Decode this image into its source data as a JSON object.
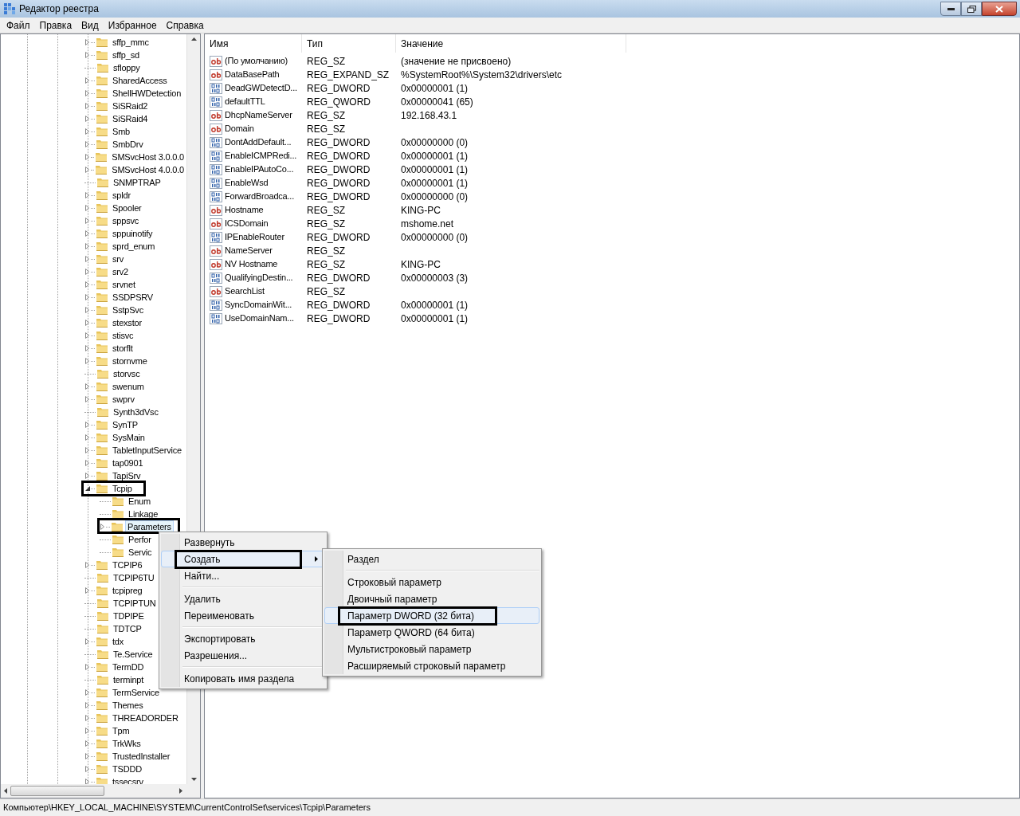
{
  "window": {
    "title": "Редактор реестра"
  },
  "menu": [
    "Файл",
    "Правка",
    "Вид",
    "Избранное",
    "Справка"
  ],
  "tree": [
    {
      "label": "sffp_mmc",
      "expandable": true
    },
    {
      "label": "sffp_sd",
      "expandable": true
    },
    {
      "label": "sfloppy",
      "expandable": false
    },
    {
      "label": "SharedAccess",
      "expandable": true
    },
    {
      "label": "ShellHWDetection",
      "expandable": true
    },
    {
      "label": "SiSRaid2",
      "expandable": true
    },
    {
      "label": "SiSRaid4",
      "expandable": true
    },
    {
      "label": "Smb",
      "expandable": true
    },
    {
      "label": "SmbDrv",
      "expandable": true
    },
    {
      "label": "SMSvcHost 3.0.0.0",
      "expandable": true
    },
    {
      "label": "SMSvcHost 4.0.0.0",
      "expandable": true
    },
    {
      "label": "SNMPTRAP",
      "expandable": false
    },
    {
      "label": "spldr",
      "expandable": true
    },
    {
      "label": "Spooler",
      "expandable": true
    },
    {
      "label": "sppsvc",
      "expandable": true
    },
    {
      "label": "sppuinotify",
      "expandable": true
    },
    {
      "label": "sprd_enum",
      "expandable": true
    },
    {
      "label": "srv",
      "expandable": true
    },
    {
      "label": "srv2",
      "expandable": true
    },
    {
      "label": "srvnet",
      "expandable": true
    },
    {
      "label": "SSDPSRV",
      "expandable": true
    },
    {
      "label": "SstpSvc",
      "expandable": true
    },
    {
      "label": "stexstor",
      "expandable": true
    },
    {
      "label": "stisvc",
      "expandable": true
    },
    {
      "label": "storflt",
      "expandable": true
    },
    {
      "label": "stornvme",
      "expandable": true
    },
    {
      "label": "storvsc",
      "expandable": false
    },
    {
      "label": "swenum",
      "expandable": true
    },
    {
      "label": "swprv",
      "expandable": true
    },
    {
      "label": "Synth3dVsc",
      "expandable": false
    },
    {
      "label": "SynTP",
      "expandable": true
    },
    {
      "label": "SysMain",
      "expandable": true
    },
    {
      "label": "TabletInputService",
      "expandable": true
    },
    {
      "label": "tap0901",
      "expandable": true
    },
    {
      "label": "TapiSrv",
      "expandable": true
    },
    {
      "label": "Tcpip",
      "expandable": true,
      "expanded": true,
      "annotated": true,
      "children": [
        {
          "label": "Enum",
          "expandable": false
        },
        {
          "label": "Linkage",
          "expandable": false
        },
        {
          "label": "Parameters",
          "expandable": true,
          "selected": true,
          "annotated": true
        },
        {
          "label": "Perfor",
          "expandable": false
        },
        {
          "label": "Servic",
          "expandable": false
        }
      ]
    },
    {
      "label": "TCPIP6",
      "expandable": true
    },
    {
      "label": "TCPIP6TU",
      "expandable": false
    },
    {
      "label": "tcpipreg",
      "expandable": true
    },
    {
      "label": "TCPIPTUN",
      "expandable": false
    },
    {
      "label": "TDPIPE",
      "expandable": false
    },
    {
      "label": "TDTCP",
      "expandable": false
    },
    {
      "label": "tdx",
      "expandable": true
    },
    {
      "label": "Te.Service",
      "expandable": false
    },
    {
      "label": "TermDD",
      "expandable": true
    },
    {
      "label": "terminpt",
      "expandable": false
    },
    {
      "label": "TermService",
      "expandable": true
    },
    {
      "label": "Themes",
      "expandable": true
    },
    {
      "label": "THREADORDER",
      "expandable": true
    },
    {
      "label": "Tpm",
      "expandable": true
    },
    {
      "label": "TrkWks",
      "expandable": true
    },
    {
      "label": "TrustedInstaller",
      "expandable": true
    },
    {
      "label": "TSDDD",
      "expandable": true
    },
    {
      "label": "tssecsrv",
      "expandable": true
    }
  ],
  "table": {
    "columns": [
      "Имя",
      "Тип",
      "Значение"
    ],
    "rows": [
      {
        "kind": "string",
        "name": "(По умолчанию)",
        "type": "REG_SZ",
        "value": "(значение не присвоено)"
      },
      {
        "kind": "string",
        "name": "DataBasePath",
        "type": "REG_EXPAND_SZ",
        "value": "%SystemRoot%\\System32\\drivers\\etc"
      },
      {
        "kind": "binary",
        "name": "DeadGWDetectD...",
        "type": "REG_DWORD",
        "value": "0x00000001 (1)"
      },
      {
        "kind": "binary",
        "name": "defaultTTL",
        "type": "REG_QWORD",
        "value": "0x00000041 (65)"
      },
      {
        "kind": "string",
        "name": "DhcpNameServer",
        "type": "REG_SZ",
        "value": "192.168.43.1"
      },
      {
        "kind": "string",
        "name": "Domain",
        "type": "REG_SZ"
      },
      {
        "kind": "binary",
        "name": "DontAddDefault...",
        "type": "REG_DWORD",
        "value": "0x00000000 (0)"
      },
      {
        "kind": "binary",
        "name": "EnableICMPRedi...",
        "type": "REG_DWORD",
        "value": "0x00000001 (1)"
      },
      {
        "kind": "binary",
        "name": "EnableIPAutoCo...",
        "type": "REG_DWORD",
        "value": "0x00000001 (1)"
      },
      {
        "kind": "binary",
        "name": "EnableWsd",
        "type": "REG_DWORD",
        "value": "0x00000001 (1)"
      },
      {
        "kind": "binary",
        "name": "ForwardBroadca...",
        "type": "REG_DWORD",
        "value": "0x00000000 (0)"
      },
      {
        "kind": "string",
        "name": "Hostname",
        "type": "REG_SZ",
        "value": "KING-PC"
      },
      {
        "kind": "string",
        "name": "ICSDomain",
        "type": "REG_SZ",
        "value": "mshome.net"
      },
      {
        "kind": "binary",
        "name": "IPEnableRouter",
        "type": "REG_DWORD",
        "value": "0x00000000 (0)"
      },
      {
        "kind": "string",
        "name": "NameServer",
        "type": "REG_SZ"
      },
      {
        "kind": "string",
        "name": "NV Hostname",
        "type": "REG_SZ",
        "value": "KING-PC"
      },
      {
        "kind": "binary",
        "name": "QualifyingDestin...",
        "type": "REG_DWORD",
        "value": "0x00000003 (3)"
      },
      {
        "kind": "string",
        "name": "SearchList",
        "type": "REG_SZ"
      },
      {
        "kind": "binary",
        "name": "SyncDomainWit...",
        "type": "REG_DWORD",
        "value": "0x00000001 (1)"
      },
      {
        "kind": "binary",
        "name": "UseDomainNam...",
        "type": "REG_DWORD",
        "value": "0x00000001 (1)"
      }
    ]
  },
  "context_menu": [
    {
      "kind": "item",
      "label": "Развернуть",
      "selected": false
    },
    {
      "kind": "item",
      "label": "Создать",
      "selected": true,
      "submenu": true,
      "annotated": true
    },
    {
      "kind": "item",
      "label": "Найти...",
      "selected": false
    },
    {
      "kind": "separator"
    },
    {
      "kind": "item",
      "label": "Удалить",
      "selected": false
    },
    {
      "kind": "item",
      "label": "Переименовать",
      "selected": false
    },
    {
      "kind": "separator"
    },
    {
      "kind": "item",
      "label": "Экспортировать",
      "selected": false
    },
    {
      "kind": "item",
      "label": "Разрешения...",
      "selected": false
    },
    {
      "kind": "separator"
    },
    {
      "kind": "item",
      "label": "Копировать имя раздела",
      "selected": false
    }
  ],
  "submenu": [
    {
      "kind": "item",
      "label": "Раздел",
      "selected": false
    },
    {
      "kind": "separator"
    },
    {
      "kind": "item",
      "label": "Строковый параметр",
      "selected": false
    },
    {
      "kind": "item",
      "label": "Двоичный параметр",
      "selected": false
    },
    {
      "kind": "item",
      "label": "Параметр DWORD (32 бита)",
      "selected": true,
      "annotated": true
    },
    {
      "kind": "item",
      "label": "Параметр QWORD (64 бита)",
      "selected": false
    },
    {
      "kind": "item",
      "label": "Мультистроковый параметр",
      "selected": false
    },
    {
      "kind": "item",
      "label": "Расширяемый строковый параметр",
      "selected": false
    }
  ],
  "status_bar": "Компьютер\\HKEY_LOCAL_MACHINE\\SYSTEM\\CurrentControlSet\\services\\Tcpip\\Parameters"
}
